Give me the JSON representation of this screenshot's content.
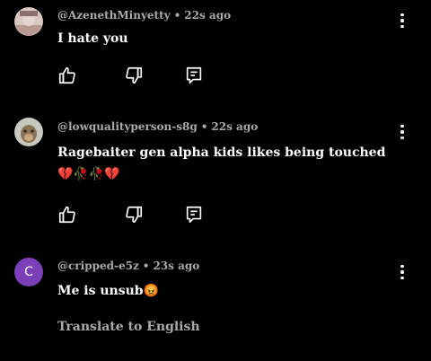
{
  "comments": [
    {
      "author": "@AzenethMinyetty",
      "time": "22s ago",
      "text": "I hate you",
      "avatar_icon": "profile-photo"
    },
    {
      "author": "@lowqualityperson-s8g",
      "time": "22s ago",
      "text": "Ragebaiter gen alpha kids likes being touched 💔🥀🥀💔",
      "avatar_icon": "profile-photo"
    },
    {
      "author": "@cripped-e5z",
      "time": "23s ago",
      "text": "Me is unsub😡",
      "avatar_letter": "C",
      "avatar_color": "#7b3fb8",
      "translate_label": "Translate to English"
    }
  ],
  "separator": "•",
  "icons": {
    "like": "thumbs-up-icon",
    "dislike": "thumbs-down-icon",
    "reply": "reply-icon",
    "more": "kebab-menu-icon"
  },
  "colors": {
    "background": "#000000",
    "text": "#ffffff",
    "meta": "#aaaaaa"
  }
}
